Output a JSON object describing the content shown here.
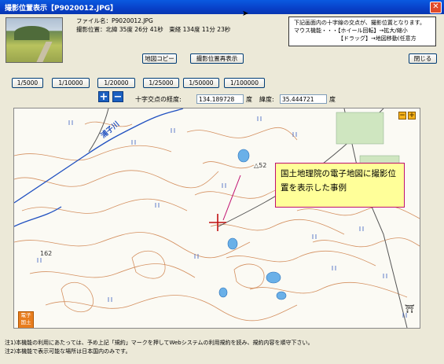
{
  "window": {
    "title": "撮影位置表示【P9020012.JPG】",
    "close_symbol": "✕"
  },
  "photo_info": {
    "file_line": "ファイル名：P9020012.JPG",
    "position_line": "撮影位置：北緯 35度 26分 41秒　東経 134度 11分 23秒"
  },
  "hint": {
    "line1": "下記画面内の十字線の交点が、撮影位置となります。",
    "line2": "マウス機能・・・【ホイール回転】→拡大/縮小",
    "line3": "【ドラッグ】→地図移動(任意方"
  },
  "buttons": {
    "map_copy": "地図コピー",
    "redisplay": "撮影位置再表示",
    "close": "閉じる"
  },
  "scales": [
    "1/5000",
    "1/10000",
    "1/20000",
    "1/25000",
    "1/50000",
    "1/100000"
  ],
  "zoom": {
    "plus": "+",
    "minus": "−"
  },
  "coords": {
    "lon_label": "十字交点の経度:",
    "lon_value": "134.189728",
    "lon_unit": "度",
    "lat_label": "緯度:",
    "lat_value": "35.444721",
    "lat_unit": "度"
  },
  "map": {
    "callout": "国土地理院の電子地図に撮影位置を表示した事例",
    "river_label": "浦子川",
    "elevation_label": "162",
    "benchmark_label": "△52",
    "zoom_minus": "−",
    "zoom_plus": "+",
    "gsi_logo_line1": "電子",
    "gsi_logo_line2": "国土",
    "shrine_symbol": "⛩",
    "water_color": "#6ab0e8",
    "contour_color": "#d49060",
    "crosshair_color": "#c01010"
  },
  "notes": {
    "line1": "注1)本機能の利用にあたっては、予め上記「規約」マークを押してWebシステムの利用規約を読み、規約内容を順守下さい。",
    "line2": "注2)本機能で表示可能な場所は日本国内のみです。"
  }
}
